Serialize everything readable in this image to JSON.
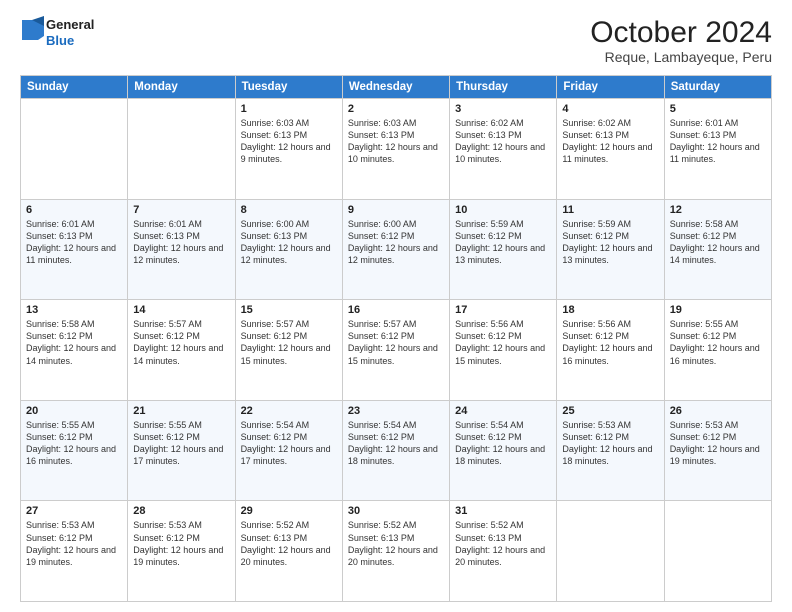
{
  "logo": {
    "general": "General",
    "blue": "Blue"
  },
  "header": {
    "month_year": "October 2024",
    "location": "Reque, Lambayeque, Peru"
  },
  "days_of_week": [
    "Sunday",
    "Monday",
    "Tuesday",
    "Wednesday",
    "Thursday",
    "Friday",
    "Saturday"
  ],
  "weeks": [
    [
      {
        "day": "",
        "sunrise": "",
        "sunset": "",
        "daylight": ""
      },
      {
        "day": "",
        "sunrise": "",
        "sunset": "",
        "daylight": ""
      },
      {
        "day": "1",
        "sunrise": "Sunrise: 6:03 AM",
        "sunset": "Sunset: 6:13 PM",
        "daylight": "Daylight: 12 hours and 9 minutes."
      },
      {
        "day": "2",
        "sunrise": "Sunrise: 6:03 AM",
        "sunset": "Sunset: 6:13 PM",
        "daylight": "Daylight: 12 hours and 10 minutes."
      },
      {
        "day": "3",
        "sunrise": "Sunrise: 6:02 AM",
        "sunset": "Sunset: 6:13 PM",
        "daylight": "Daylight: 12 hours and 10 minutes."
      },
      {
        "day": "4",
        "sunrise": "Sunrise: 6:02 AM",
        "sunset": "Sunset: 6:13 PM",
        "daylight": "Daylight: 12 hours and 11 minutes."
      },
      {
        "day": "5",
        "sunrise": "Sunrise: 6:01 AM",
        "sunset": "Sunset: 6:13 PM",
        "daylight": "Daylight: 12 hours and 11 minutes."
      }
    ],
    [
      {
        "day": "6",
        "sunrise": "Sunrise: 6:01 AM",
        "sunset": "Sunset: 6:13 PM",
        "daylight": "Daylight: 12 hours and 11 minutes."
      },
      {
        "day": "7",
        "sunrise": "Sunrise: 6:01 AM",
        "sunset": "Sunset: 6:13 PM",
        "daylight": "Daylight: 12 hours and 12 minutes."
      },
      {
        "day": "8",
        "sunrise": "Sunrise: 6:00 AM",
        "sunset": "Sunset: 6:13 PM",
        "daylight": "Daylight: 12 hours and 12 minutes."
      },
      {
        "day": "9",
        "sunrise": "Sunrise: 6:00 AM",
        "sunset": "Sunset: 6:12 PM",
        "daylight": "Daylight: 12 hours and 12 minutes."
      },
      {
        "day": "10",
        "sunrise": "Sunrise: 5:59 AM",
        "sunset": "Sunset: 6:12 PM",
        "daylight": "Daylight: 12 hours and 13 minutes."
      },
      {
        "day": "11",
        "sunrise": "Sunrise: 5:59 AM",
        "sunset": "Sunset: 6:12 PM",
        "daylight": "Daylight: 12 hours and 13 minutes."
      },
      {
        "day": "12",
        "sunrise": "Sunrise: 5:58 AM",
        "sunset": "Sunset: 6:12 PM",
        "daylight": "Daylight: 12 hours and 14 minutes."
      }
    ],
    [
      {
        "day": "13",
        "sunrise": "Sunrise: 5:58 AM",
        "sunset": "Sunset: 6:12 PM",
        "daylight": "Daylight: 12 hours and 14 minutes."
      },
      {
        "day": "14",
        "sunrise": "Sunrise: 5:57 AM",
        "sunset": "Sunset: 6:12 PM",
        "daylight": "Daylight: 12 hours and 14 minutes."
      },
      {
        "day": "15",
        "sunrise": "Sunrise: 5:57 AM",
        "sunset": "Sunset: 6:12 PM",
        "daylight": "Daylight: 12 hours and 15 minutes."
      },
      {
        "day": "16",
        "sunrise": "Sunrise: 5:57 AM",
        "sunset": "Sunset: 6:12 PM",
        "daylight": "Daylight: 12 hours and 15 minutes."
      },
      {
        "day": "17",
        "sunrise": "Sunrise: 5:56 AM",
        "sunset": "Sunset: 6:12 PM",
        "daylight": "Daylight: 12 hours and 15 minutes."
      },
      {
        "day": "18",
        "sunrise": "Sunrise: 5:56 AM",
        "sunset": "Sunset: 6:12 PM",
        "daylight": "Daylight: 12 hours and 16 minutes."
      },
      {
        "day": "19",
        "sunrise": "Sunrise: 5:55 AM",
        "sunset": "Sunset: 6:12 PM",
        "daylight": "Daylight: 12 hours and 16 minutes."
      }
    ],
    [
      {
        "day": "20",
        "sunrise": "Sunrise: 5:55 AM",
        "sunset": "Sunset: 6:12 PM",
        "daylight": "Daylight: 12 hours and 16 minutes."
      },
      {
        "day": "21",
        "sunrise": "Sunrise: 5:55 AM",
        "sunset": "Sunset: 6:12 PM",
        "daylight": "Daylight: 12 hours and 17 minutes."
      },
      {
        "day": "22",
        "sunrise": "Sunrise: 5:54 AM",
        "sunset": "Sunset: 6:12 PM",
        "daylight": "Daylight: 12 hours and 17 minutes."
      },
      {
        "day": "23",
        "sunrise": "Sunrise: 5:54 AM",
        "sunset": "Sunset: 6:12 PM",
        "daylight": "Daylight: 12 hours and 18 minutes."
      },
      {
        "day": "24",
        "sunrise": "Sunrise: 5:54 AM",
        "sunset": "Sunset: 6:12 PM",
        "daylight": "Daylight: 12 hours and 18 minutes."
      },
      {
        "day": "25",
        "sunrise": "Sunrise: 5:53 AM",
        "sunset": "Sunset: 6:12 PM",
        "daylight": "Daylight: 12 hours and 18 minutes."
      },
      {
        "day": "26",
        "sunrise": "Sunrise: 5:53 AM",
        "sunset": "Sunset: 6:12 PM",
        "daylight": "Daylight: 12 hours and 19 minutes."
      }
    ],
    [
      {
        "day": "27",
        "sunrise": "Sunrise: 5:53 AM",
        "sunset": "Sunset: 6:12 PM",
        "daylight": "Daylight: 12 hours and 19 minutes."
      },
      {
        "day": "28",
        "sunrise": "Sunrise: 5:53 AM",
        "sunset": "Sunset: 6:12 PM",
        "daylight": "Daylight: 12 hours and 19 minutes."
      },
      {
        "day": "29",
        "sunrise": "Sunrise: 5:52 AM",
        "sunset": "Sunset: 6:13 PM",
        "daylight": "Daylight: 12 hours and 20 minutes."
      },
      {
        "day": "30",
        "sunrise": "Sunrise: 5:52 AM",
        "sunset": "Sunset: 6:13 PM",
        "daylight": "Daylight: 12 hours and 20 minutes."
      },
      {
        "day": "31",
        "sunrise": "Sunrise: 5:52 AM",
        "sunset": "Sunset: 6:13 PM",
        "daylight": "Daylight: 12 hours and 20 minutes."
      },
      {
        "day": "",
        "sunrise": "",
        "sunset": "",
        "daylight": ""
      },
      {
        "day": "",
        "sunrise": "",
        "sunset": "",
        "daylight": ""
      }
    ]
  ]
}
